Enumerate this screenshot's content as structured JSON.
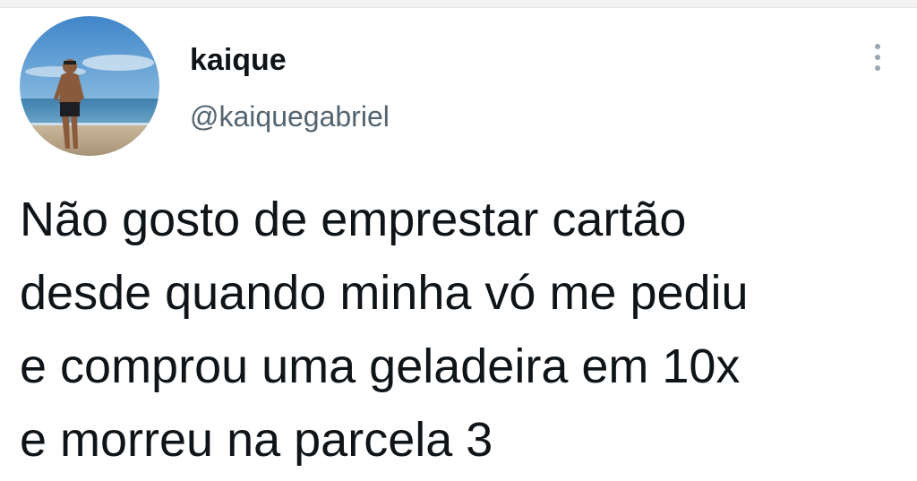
{
  "user": {
    "display_name": "kaique",
    "handle": "@kaiquegabriel",
    "avatar_icon": "profile-photo-beach"
  },
  "menu": {
    "icon": "more-vertical-icon"
  },
  "tweet": {
    "lines": [
      "Não gosto de emprestar cartão",
      "desde quando minha vó me pediu",
      "e comprou uma geladeira em 10x",
      "e morreu na parcela 3"
    ]
  },
  "colors": {
    "text_primary": "#0f1419",
    "text_secondary": "#536471",
    "background": "#ffffff"
  }
}
